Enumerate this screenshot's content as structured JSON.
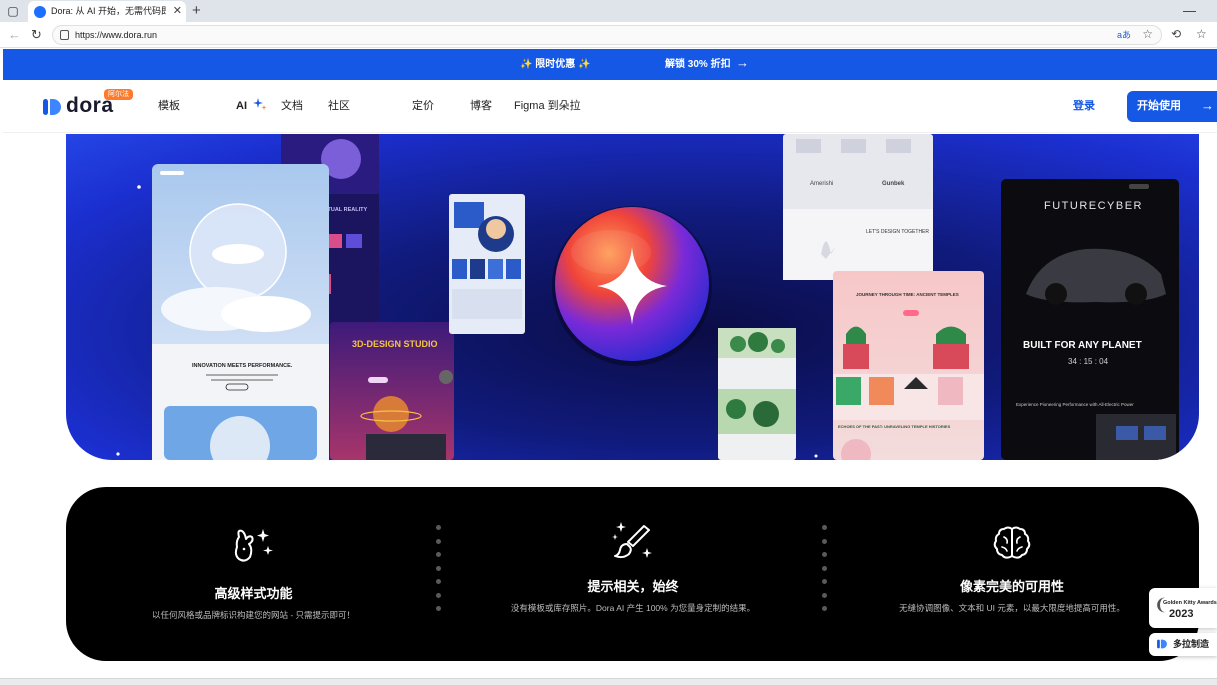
{
  "browser": {
    "tab_title": "Dora: 从 AI 开始，无需代码即可",
    "url": "https://www.dora.run",
    "read_aloud": "aあ"
  },
  "promo": {
    "left_text": "✨ 限时优惠 ✨",
    "right_text": "解锁 30% 折扣",
    "arrow": "→"
  },
  "header": {
    "logo_text": "dora",
    "logo_badge": "阿尔法",
    "nav": {
      "templates": "模板",
      "ai": "AI",
      "docs": "文档",
      "community": "社区",
      "pricing": "定价",
      "blog": "博客",
      "figma": "Figma 到朵拉"
    },
    "login": "登录",
    "start": "开始使用",
    "start_arrow": "→"
  },
  "hero": {
    "card_left_heading": "INNOVATION MEETS PERFORMANCE.",
    "card_vr_heading": "STEP INTO VIRTUAL REALITY",
    "card_3d_title": "3D-DESIGN STUDIO",
    "card_brands": [
      "Amerishi",
      "Gunbek"
    ],
    "card_design": "LET'S DESIGN TOGETHER",
    "card_temple_heading": "JOURNEY THROUGH TIME: ANCIENT TEMPLES",
    "card_temple_footer": "ECHOES OF THE PAST: UNRAVELING TEMPLE HISTORIES",
    "card_right_title": "FUTURECYBER",
    "card_right_heading": "BUILT FOR ANY PLANET",
    "card_right_timer": "34 : 15 : 04",
    "card_right_note": "Experience Pioneering Performance with All-Electric Power"
  },
  "features": [
    {
      "title": "高级样式功能",
      "desc": "以任何风格或品牌标识构建您的网站 - 只需提示即可！",
      "icon": "rabbit-sparkle-icon"
    },
    {
      "title": "提示相关，始终",
      "desc": "没有模板或库存照片。Dora AI 产生 100% 为您量身定制的结果。",
      "icon": "paintbrush-sparkle-icon"
    },
    {
      "title": "像素完美的可用性",
      "desc": "无缝协调图像、文本和 UI 元素，以最大限度地提高可用性。",
      "icon": "brain-icon"
    }
  ],
  "award": {
    "name": "Golden Kitty Awards",
    "year": "2023"
  },
  "made_with": "多拉制造",
  "colors": {
    "brand_blue": "#1658e6",
    "badge_orange": "#ff7a2b"
  }
}
